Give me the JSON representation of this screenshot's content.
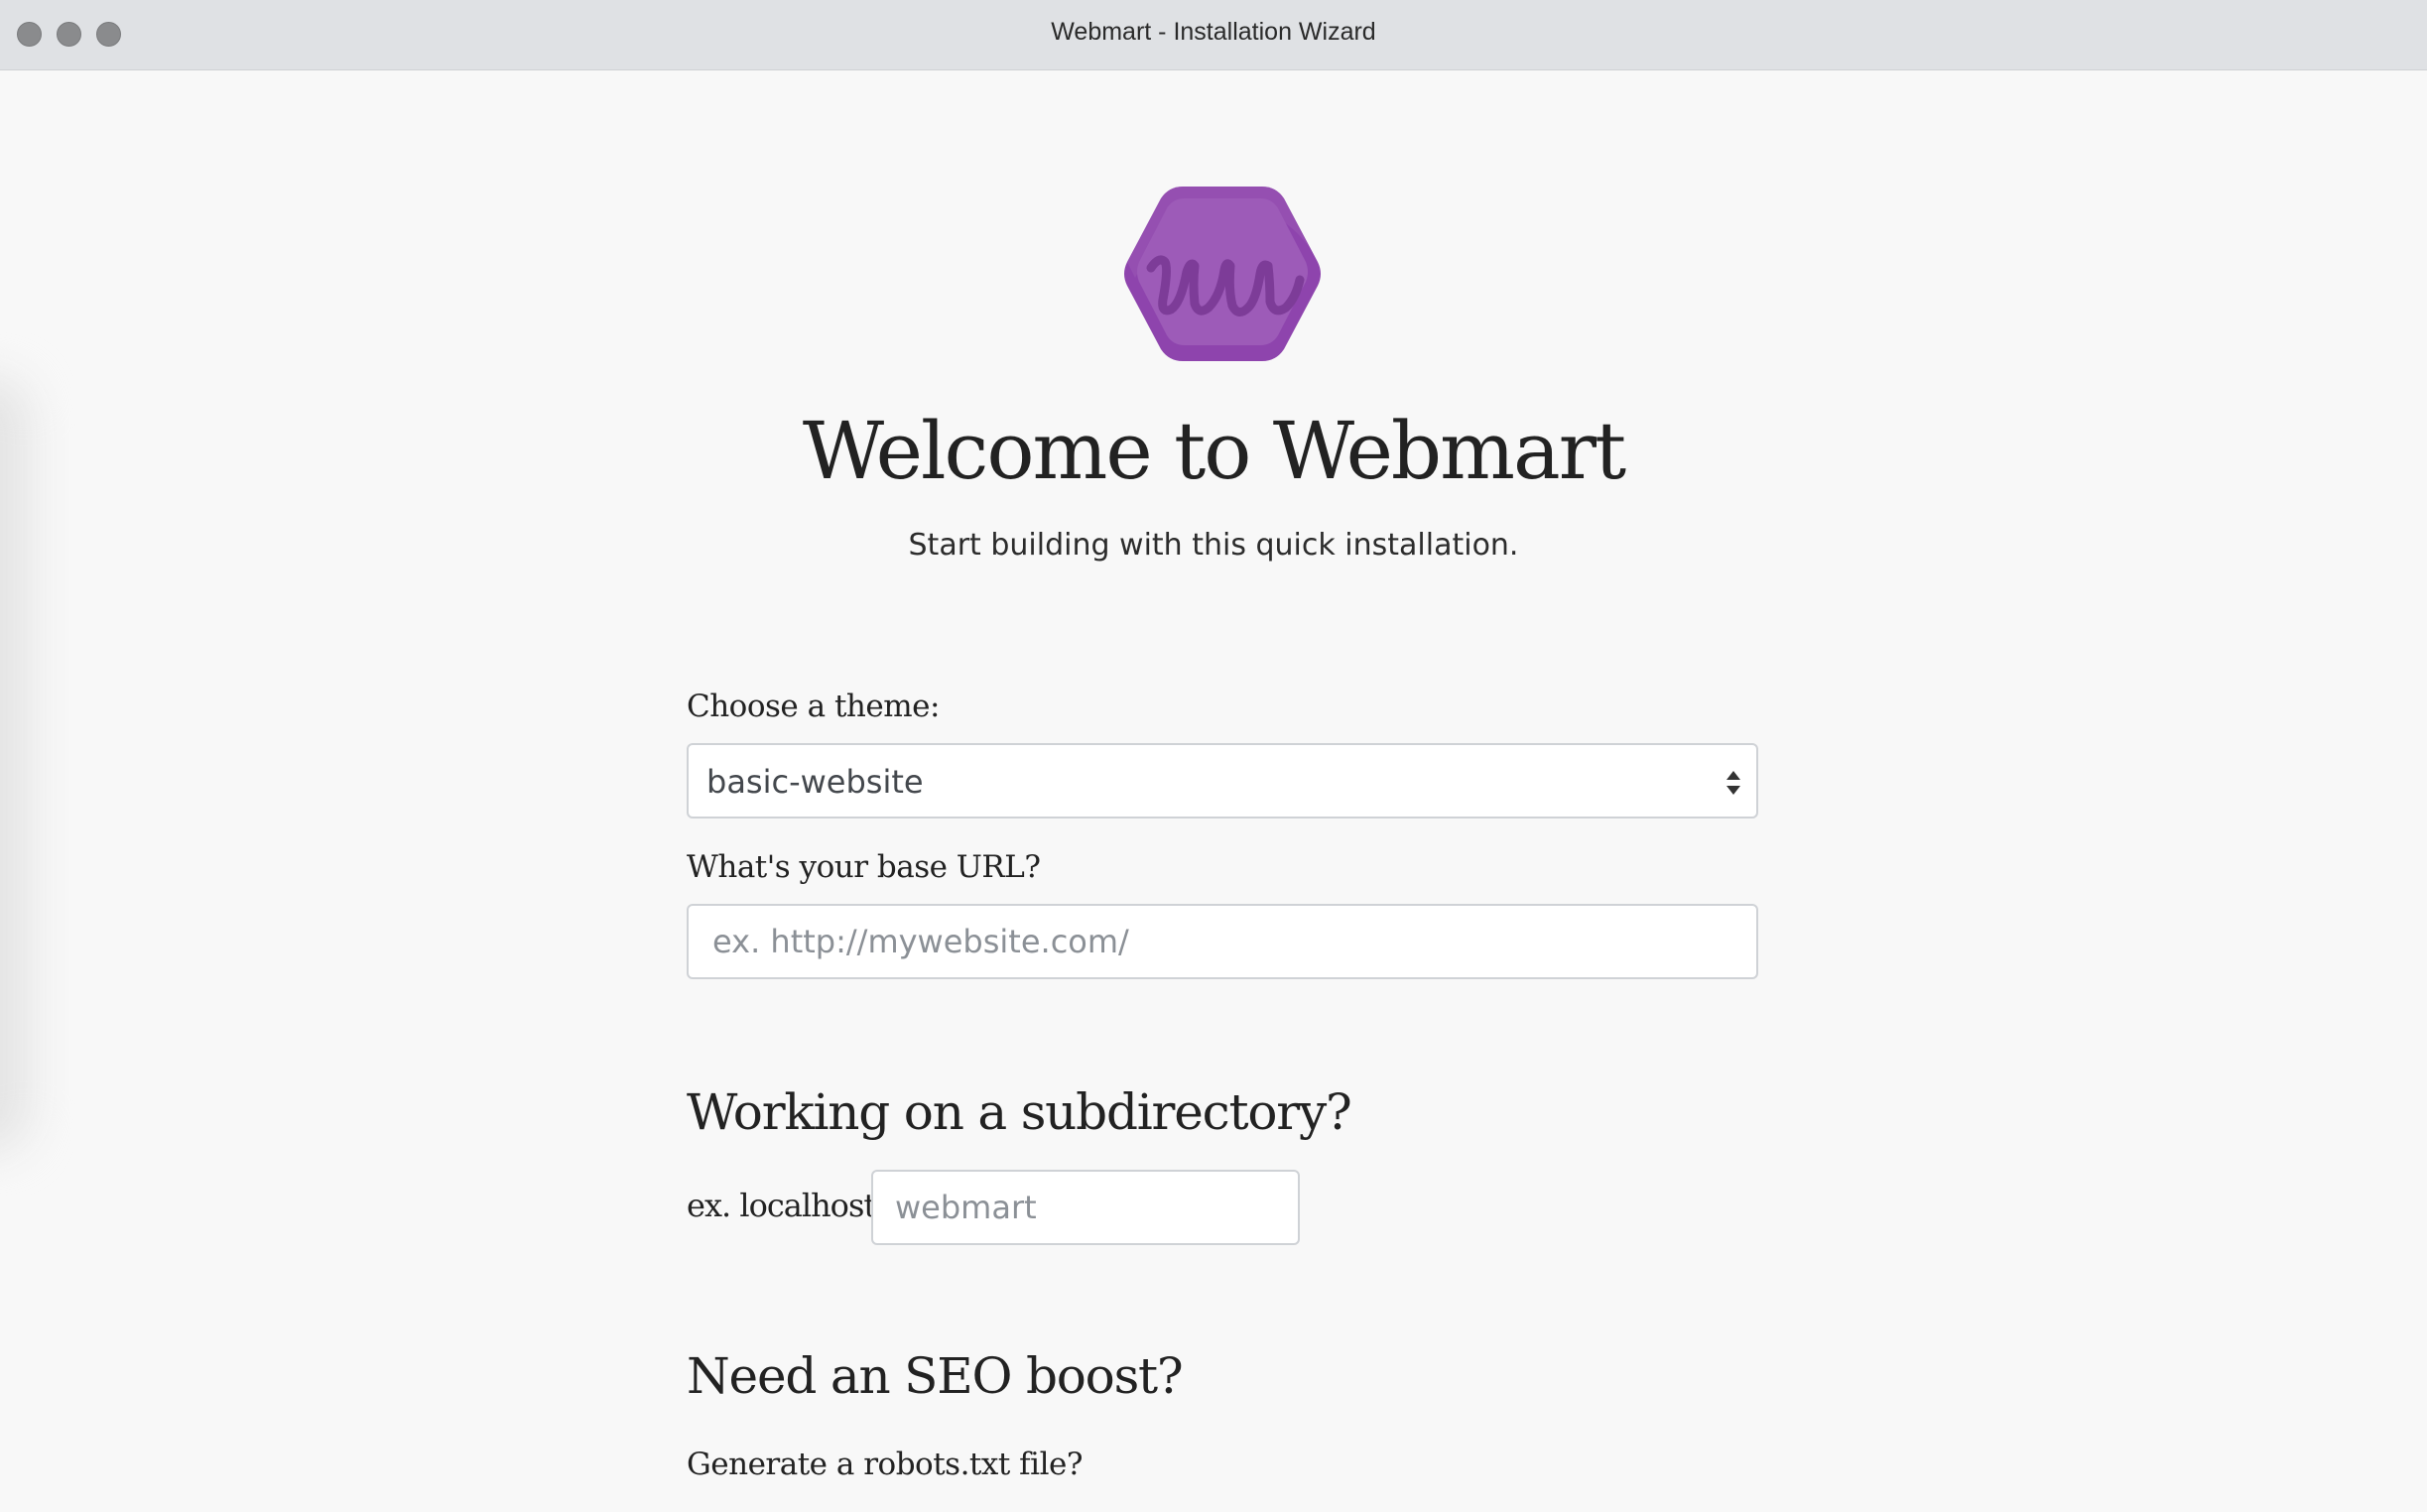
{
  "window": {
    "title": "Webmart - Installation Wizard"
  },
  "logo": {
    "brand_color": "#9b59b6",
    "letters": "wu"
  },
  "header": {
    "title": "Welcome to Webmart",
    "subtitle": "Start building with this quick installation."
  },
  "theme": {
    "label": "Choose a theme:",
    "selected": "basic-website"
  },
  "base_url": {
    "label": "What's your base URL?",
    "placeholder": "ex. http://mywebsite.com/",
    "value": ""
  },
  "subdirectory": {
    "heading": "Working on a subdirectory?",
    "prefix": "ex. localhost/",
    "placeholder": "webmart",
    "value": ""
  },
  "seo": {
    "heading": "Need an SEO boost?",
    "robots_label": "Generate a robots.txt file?"
  }
}
